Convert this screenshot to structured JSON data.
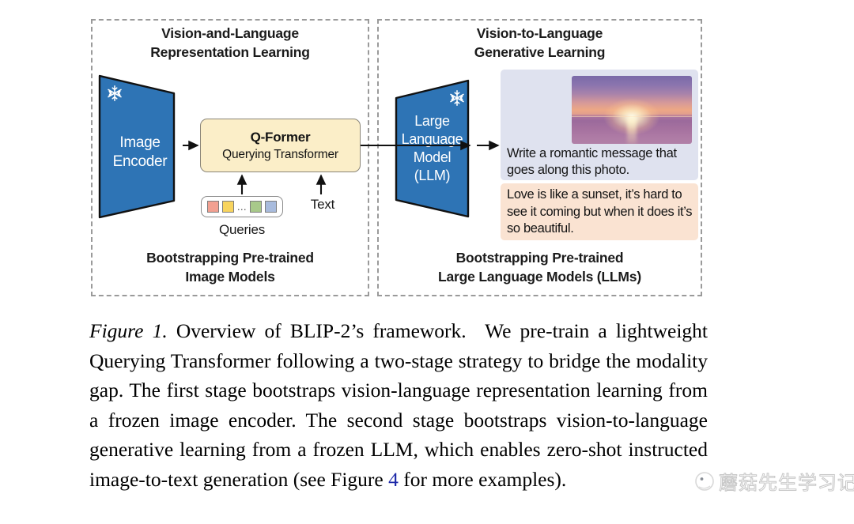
{
  "figure": {
    "stage1": {
      "title_line1": "Vision-and-Language",
      "title_line2": "Representation Learning",
      "footer_line1": "Bootstrapping Pre-trained",
      "footer_line2": "Image Models",
      "image_encoder": {
        "line1": "Image",
        "line2": "Encoder",
        "frozen_icon": "snowflake-icon",
        "color": "#2e74b5"
      },
      "qformer": {
        "title": "Q-Former",
        "subtitle": "Querying Transformer",
        "fill": "#fbeec8"
      },
      "queries": {
        "label": "Queries",
        "ellipsis": "⋯",
        "chips": [
          "#f2a091",
          "#f8d45e",
          "#a8c98a",
          "#a8bbdd"
        ]
      },
      "text_input_label": "Text"
    },
    "stage2": {
      "title_line1": "Vision-to-Language",
      "title_line2": "Generative Learning",
      "footer_line1": "Bootstrapping Pre-trained",
      "footer_line2": "Large Language Models (LLMs)",
      "llm": {
        "line1": "Large",
        "line2": "Language",
        "line3": "Model",
        "line4": "(LLM)",
        "frozen_icon": "snowflake-icon",
        "color": "#2e74b5"
      },
      "demo": {
        "photo_alt": "sunset-over-ocean-photo",
        "prompt": "Write a romantic message that goes along this photo.",
        "prompt_bg": "#dfe2ef",
        "answer": "Love is like a sunset, it’s hard to see it coming but when it does it’s so beautiful.",
        "answer_bg": "#fae3d2"
      }
    }
  },
  "caption": {
    "label": "Figure 1.",
    "part1": " Overview of BLIP-2’s framework.  We pre-train a lightweight Querying Transformer following a two-stage strategy to bridge the modality gap. The first stage bootstraps vision-language representation learning from a frozen image encoder. The second stage bootstraps vision-to-language generative learning from a frozen LLM, which enables zero-shot instructed image-to-text generation (see Figure ",
    "reference": "4",
    "part2": " for more examples)."
  },
  "watermark": {
    "text": "蘑菇先生学习记",
    "logo": "circle-logo-icon"
  }
}
